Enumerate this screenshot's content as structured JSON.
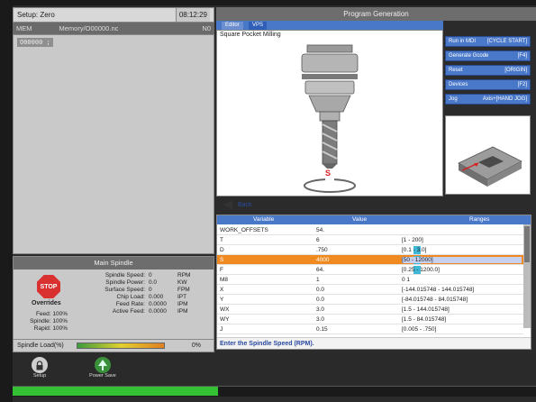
{
  "header": {
    "setup_label": "Setup: Zero",
    "time": "08:12:29"
  },
  "mem_bar": {
    "mode": "MEM",
    "path": "Memory/O00000.nc",
    "n": "N0"
  },
  "program": {
    "line": "O00000 ;"
  },
  "main_spindle": {
    "title": "Main Spindle",
    "stop_label": "STOP",
    "overrides_label": "Overrides",
    "overrides": [
      {
        "label": "Feed:",
        "value": "100%"
      },
      {
        "label": "Spindle:",
        "value": "100%"
      },
      {
        "label": "Rapid:",
        "value": "100%"
      }
    ],
    "stats": [
      {
        "label": "Spindle Speed:",
        "value": "0",
        "unit": "RPM"
      },
      {
        "label": "Spindle Power:",
        "value": "0.0",
        "unit": "KW"
      },
      {
        "label": "Surface Speed:",
        "value": "0",
        "unit": "FPM"
      },
      {
        "label": "Chip Load:",
        "value": "0.000",
        "unit": "IPT"
      },
      {
        "label": "Feed Rate:",
        "value": "0.0000",
        "unit": "IPM"
      },
      {
        "label": "Active Feed:",
        "value": "0.0000",
        "unit": "IPM"
      }
    ],
    "load_label": "Spindle Load(%)",
    "load_value": "0%",
    "load_fraction": 0
  },
  "program_generation": {
    "title": "Program Generation",
    "tabs": [
      "Editor",
      "VPS"
    ],
    "vps_title": "Square Pocket Milling",
    "marker_letter": "S",
    "back_label": "Back"
  },
  "side_buttons": [
    {
      "label": "Run in MDI",
      "key": "[CYCLE START]"
    },
    {
      "label": "Generate Gcode",
      "key": "[F4]"
    },
    {
      "label": "Reset",
      "key": "[ORIGIN]"
    },
    {
      "label": "Devices",
      "key": "[F2]"
    },
    {
      "label": "Jog",
      "key": "Axis+[HAND JOG]"
    }
  ],
  "table": {
    "headers": [
      "Variable",
      "Value",
      "Ranges"
    ],
    "rows": [
      {
        "variable": "WORK_OFFSETS",
        "value": "54.",
        "range": ""
      },
      {
        "variable": "T",
        "value": "6",
        "range": "[1 - 200]"
      },
      {
        "variable": "D",
        "value": ".750",
        "range": "[0.1 - 3.0]"
      },
      {
        "variable": "S",
        "value": "4000",
        "range": "[50 - 12000]"
      },
      {
        "variable": "F",
        "value": "64.",
        "range": "[0.25 - 1200.0]"
      },
      {
        "variable": "M8",
        "value": "1",
        "range": "0 1"
      },
      {
        "variable": "X",
        "value": "0.0",
        "range": "[-144.015748 - 144.015748]"
      },
      {
        "variable": "Y",
        "value": "0.0",
        "range": "[-84.015748 - 84.015748]"
      },
      {
        "variable": "WX",
        "value": "3.0",
        "range": "[1.5 - 144.015748]"
      },
      {
        "variable": "WY",
        "value": "3.0",
        "range": "[1.5 - 84.015748]"
      },
      {
        "variable": "J",
        "value": "0.15",
        "range": "[0.005 - .750]"
      }
    ],
    "hint": "Enter the Spindle Speed (RPM)."
  },
  "bottom_tools": [
    {
      "label": "Setup",
      "icon": "lock-icon"
    },
    {
      "label": "Power Save",
      "icon": "tree-icon"
    }
  ],
  "status": {
    "text": ""
  }
}
